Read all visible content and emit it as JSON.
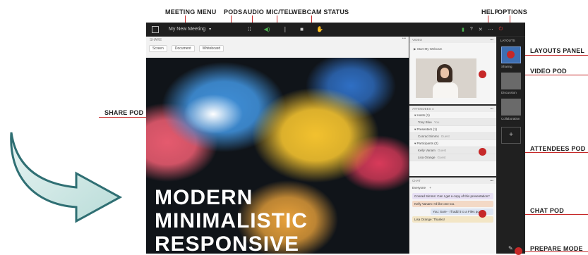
{
  "callouts": {
    "meeting_menu": "MEETING MENU",
    "pods": "PODS",
    "audio": "AUDIO",
    "mic_tel": "MIC/TEL",
    "webcam_status": "WEBCAM STATUS",
    "help": "HELP",
    "options": "OPTIONS",
    "layouts_panel": "LAYOUTS PANEL",
    "video_pod": "VIDEO POD",
    "share_pod": "SHARE POD",
    "attendees_pod": "ATTENDEES POD",
    "chat_pod": "CHAT POD",
    "prepare_mode": "PREPARE MODE"
  },
  "colors": {
    "callout_red": "#c62828",
    "app_dark": "#1e1e1e"
  },
  "topbar": {
    "meeting_name": "My New Meeting",
    "menu_icon": "grid-icon"
  },
  "share": {
    "title": "SHARE",
    "tools": [
      "Screen",
      "Document",
      "Whiteboard"
    ],
    "art_lines": [
      "MODERN",
      "MINIMALISTIC",
      "RESPONSIVE"
    ]
  },
  "video": {
    "title": "VIDEO",
    "start_label": "Start My Webcam"
  },
  "attendees": {
    "title": "ATTENDEES",
    "count": "4",
    "groups": [
      {
        "label": "Hosts (1)",
        "people": [
          {
            "name": "Tony Blue",
            "role": "You"
          }
        ]
      },
      {
        "label": "Presenters (1)",
        "people": [
          {
            "name": "Conrad Simms",
            "role": "Guest"
          }
        ]
      },
      {
        "label": "Participants (2)",
        "people": [
          {
            "name": "Kelly Vanam",
            "role": "Guest"
          },
          {
            "name": "Lisa Orange",
            "role": "Guest"
          }
        ]
      }
    ]
  },
  "chat": {
    "title": "CHAT",
    "tab": "Everyone",
    "messages": [
      "Conrad Simms: Can I get a copy of this presentation?",
      "Kelly Vanam: I'd like one too.",
      "You: Sure - I'll add it to a Files pod.",
      "Lisa Orange: Thanks!"
    ]
  },
  "layouts": {
    "title": "LAYOUTS",
    "items": [
      "Sharing",
      "Discussion",
      "Collaboration"
    ],
    "add": "+"
  }
}
